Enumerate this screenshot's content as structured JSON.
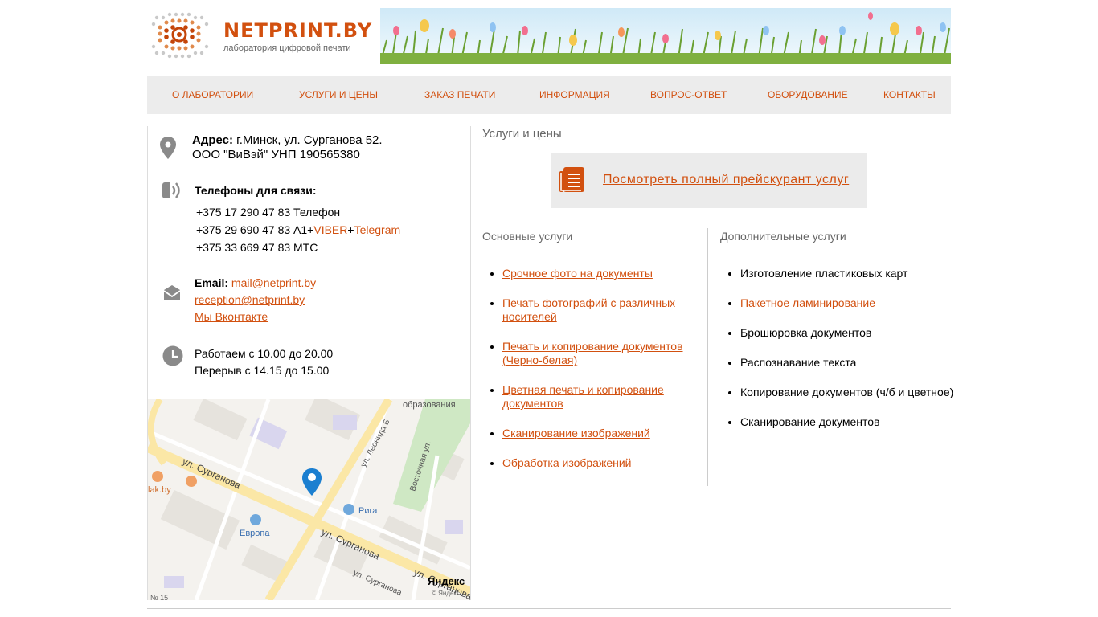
{
  "header": {
    "logo_title": "NETPRINT.BY",
    "logo_subtitle": "лаборатория цифровой печати"
  },
  "nav": [
    {
      "label": "О ЛАБОРАТОРИИ"
    },
    {
      "label": "УСЛУГИ И ЦЕНЫ"
    },
    {
      "label": "ЗАКАЗ ПЕЧАТИ"
    },
    {
      "label": "ИНФОРМАЦИЯ"
    },
    {
      "label": "ВОПРОС-ОТВЕТ"
    },
    {
      "label": "ОБОРУДОВАНИЕ"
    },
    {
      "label": "КОНТАКТЫ"
    }
  ],
  "contacts": {
    "address_label": "Адрес:",
    "address_value": " г.Минск, ул. Сурганова 52.",
    "company": "ООО \"ВиВэй\" УНП 190565380",
    "phones_label": "Телефоны для связи:",
    "phone1": "+375 17 290 47 83 Телефон",
    "phone2": "+375 29 690 47 83 А1+",
    "viber": "VIBER",
    "plus": "+",
    "telegram": "Telegram",
    "phone3": "+375 33 669 47 83 МТС",
    "email_label": "Email:",
    "email1": "mail@netprint.by",
    "email2": "reception@netprint.by",
    "vk": "Мы Вконтакте",
    "hours1": "Работаем с 10.00 до 20.00",
    "hours2": "Перерыв с 14.15 до 15.00"
  },
  "map": {
    "street1": "ул. Сурганова",
    "street2": "ул. Сурганова",
    "street3": "ул. Сурганова",
    "street4": "ул. Сурганова",
    "street_leonida": "ул. Леонида Б",
    "street_vostochnaya": "Восточная ул.",
    "poi_obrazovaniya": "образования",
    "poi_riga": "Рига",
    "poi_evropa": "Европа",
    "poi_lak": "lak.by",
    "yandex": "Яндекс",
    "number": "№ 15",
    "copyright": "© Яндекс"
  },
  "main": {
    "title": "Услуги и цены",
    "price_link": "Посмотреть полный прейскурант услуг",
    "basic_title": "Основные услуги",
    "extra_title": "Дополнительные услуги",
    "basic": [
      "Срочное фото на документы",
      "Печать фотографий с различных носителей",
      "Печать и копирование документов (Черно-белая)",
      "Цветная печать и копирование документов",
      "Сканирование изображений",
      "Обработка изображений"
    ],
    "extra": [
      "Изготовление пластиковых карт",
      "Пакетное ламинирование",
      "Брошюровка документов",
      "Распознавание текста",
      "Копирование документов (ч/б и цветное)",
      "Сканирование документов"
    ]
  },
  "colors": {
    "accent": "#d2500f",
    "nav_bg": "#ececec",
    "icon_gray": "#888888"
  }
}
